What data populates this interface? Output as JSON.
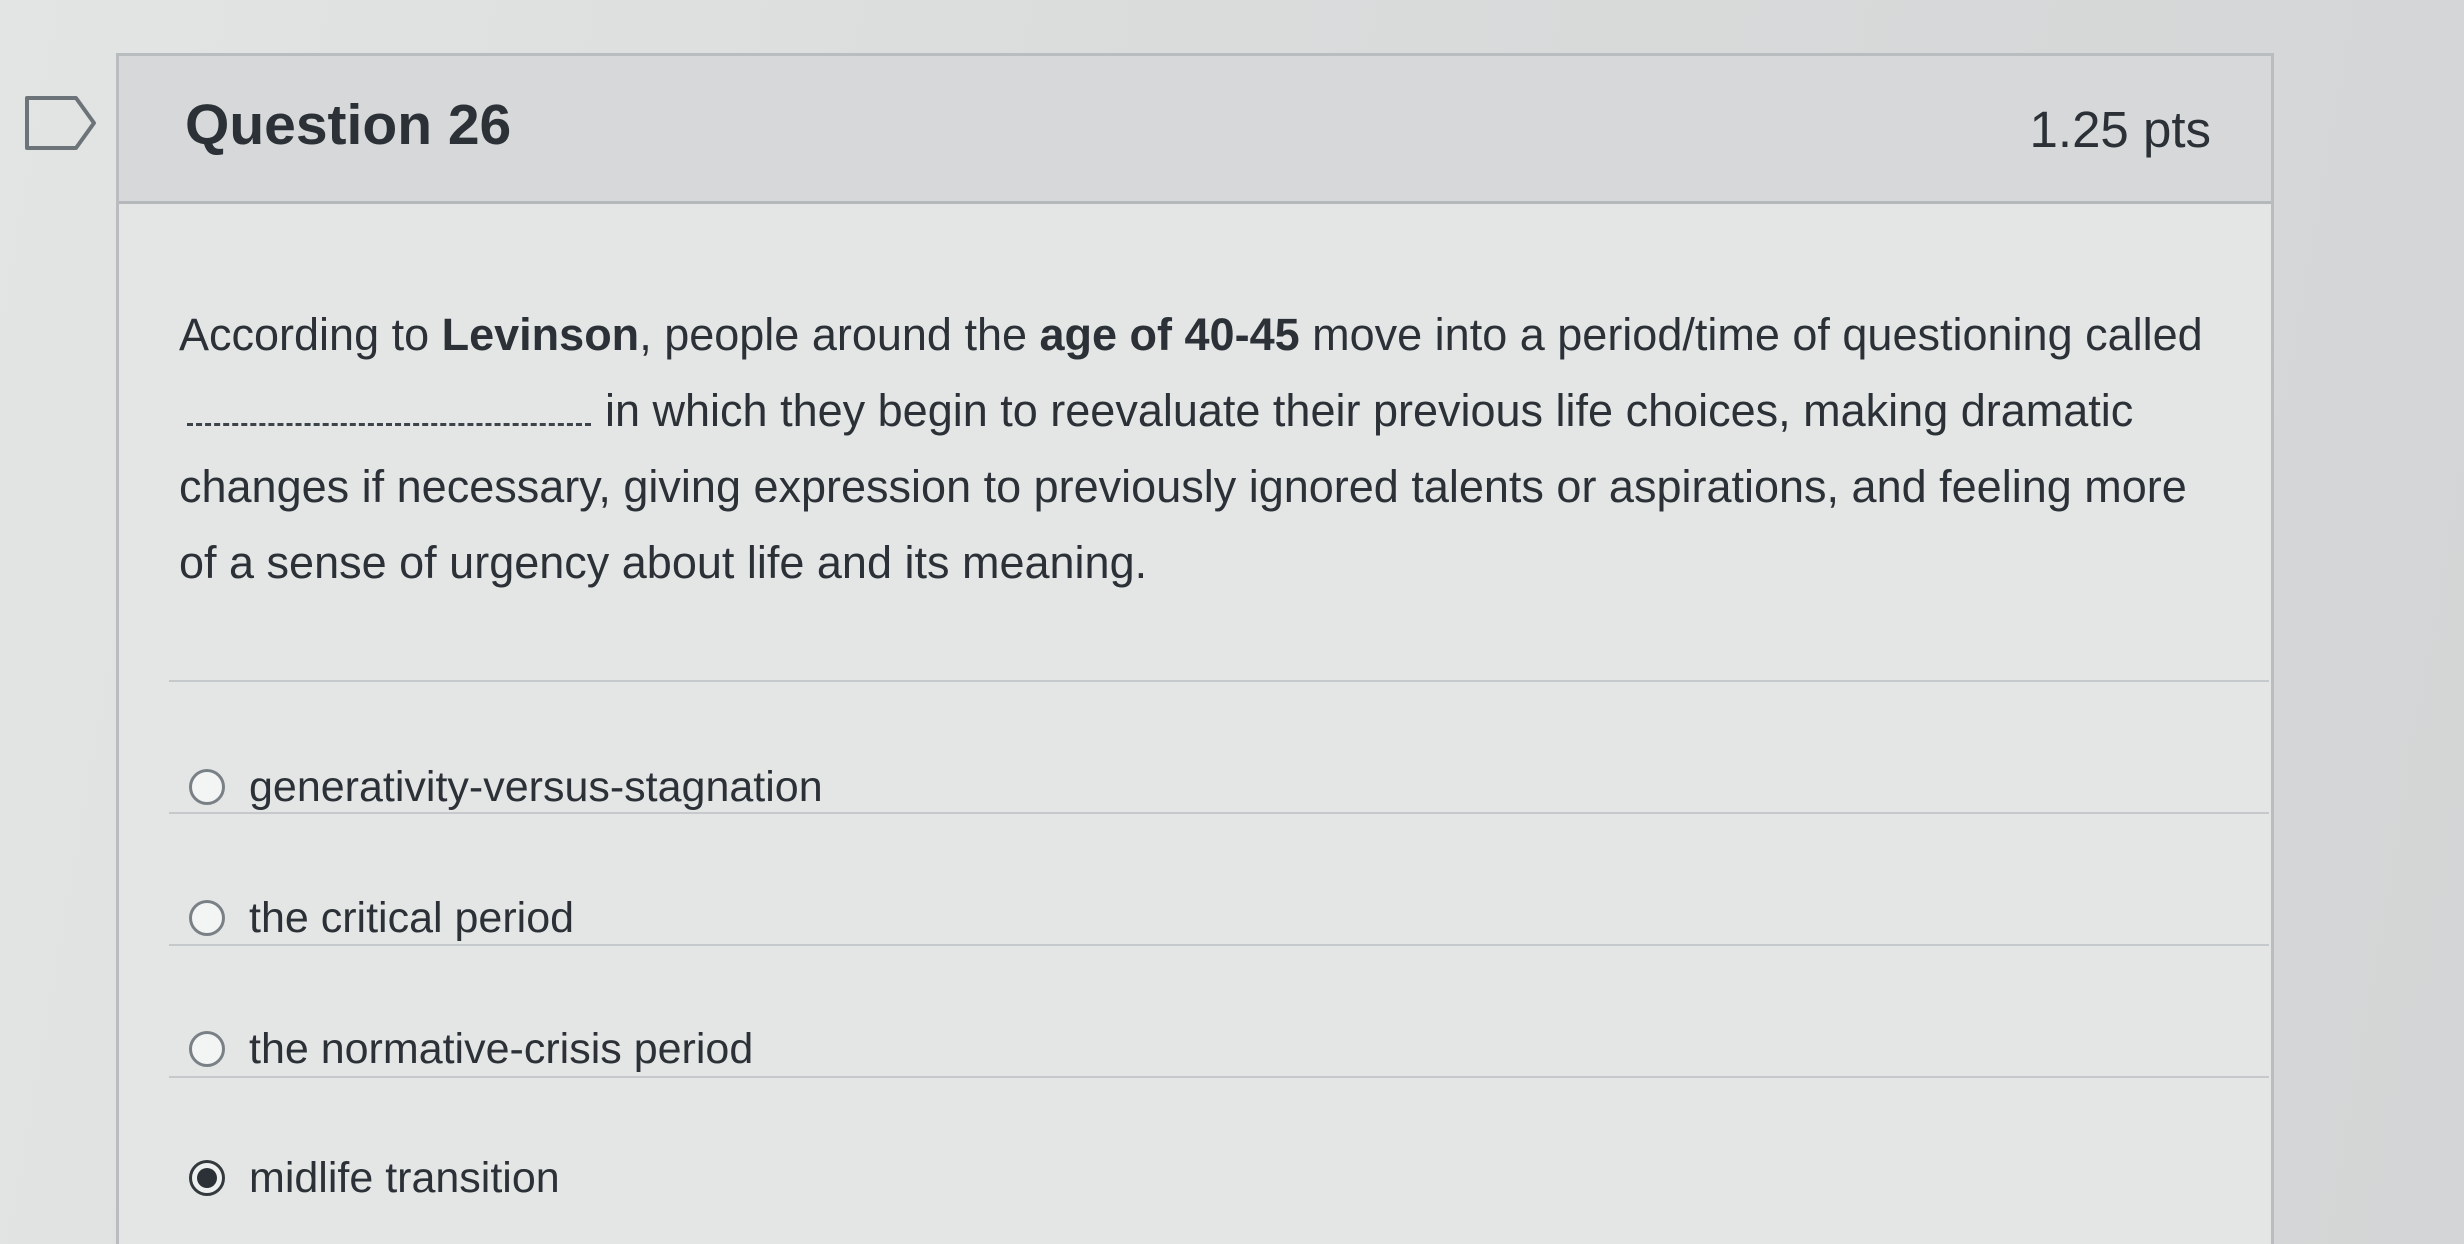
{
  "question": {
    "title": "Question 26",
    "points": "1.25 pts",
    "text": {
      "p1": "According to ",
      "b1": "Levinson",
      "p2": ", people around the ",
      "b2": "age of 40-45",
      "p3": " move into a period/time of questioning called",
      "p4": "in which they begin to reevaluate their previous life choices, making dramatic changes if necessary, giving expression to previously ignored talents or aspirations, and feeling more of a sense of urgency about life and its meaning."
    }
  },
  "answers": [
    {
      "label": "generativity-versus-stagnation",
      "selected": false
    },
    {
      "label": "the critical period",
      "selected": false
    },
    {
      "label": "the normative-crisis period",
      "selected": false
    },
    {
      "label": "midlife transition",
      "selected": true
    }
  ],
  "icons": {
    "flag": "flag-icon",
    "radio": "radio-icon"
  },
  "colors": {
    "text": "#2b3136",
    "header_bg": "#d6d8d9",
    "card_bg": "#e4e6e6"
  }
}
